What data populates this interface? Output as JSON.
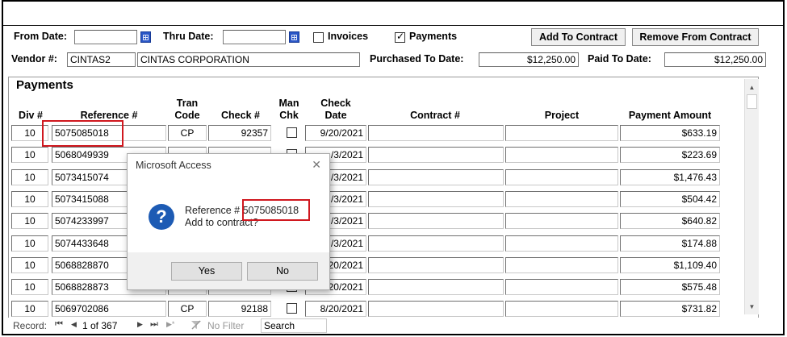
{
  "filters": {
    "from_date_label": "From Date:",
    "from_date_value": "",
    "thru_date_label": "Thru Date:",
    "thru_date_value": "",
    "invoices_label": "Invoices",
    "invoices_checked": false,
    "payments_label": "Payments",
    "payments_checked": true,
    "add_to_contract": "Add To Contract",
    "remove_from_contract": "Remove From Contract",
    "vendor_label": "Vendor #:",
    "vendor_code": "CINTAS2",
    "vendor_name": "CINTAS CORPORATION",
    "purchased_label": "Purchased To Date:",
    "purchased_value": "$12,250.00",
    "paid_label": "Paid To Date:",
    "paid_value": "$12,250.00"
  },
  "payments": {
    "title": "Payments",
    "headers": {
      "div": "Div #",
      "reference": "Reference #",
      "tran_code_1": "Tran",
      "tran_code_2": "Code",
      "check": "Check #",
      "man_chk_1": "Man",
      "man_chk_2": "Chk",
      "check_date_1": "Check",
      "check_date_2": "Date",
      "contract": "Contract #",
      "project": "Project",
      "amount": "Payment Amount"
    },
    "rows": [
      {
        "div": "10",
        "reference": "5075085018",
        "tran": "CP",
        "check": "92357",
        "date": "9/20/2021",
        "contract": "",
        "project": "",
        "amount": "$633.19"
      },
      {
        "div": "10",
        "reference": "5068049939",
        "tran": "",
        "check": "",
        "date": "/3/2021",
        "contract": "",
        "project": "",
        "amount": "$223.69"
      },
      {
        "div": "10",
        "reference": "5073415074",
        "tran": "",
        "check": "",
        "date": "/3/2021",
        "contract": "",
        "project": "",
        "amount": "$1,476.43"
      },
      {
        "div": "10",
        "reference": "5073415088",
        "tran": "",
        "check": "",
        "date": "/3/2021",
        "contract": "",
        "project": "",
        "amount": "$504.42"
      },
      {
        "div": "10",
        "reference": "5074233997",
        "tran": "",
        "check": "",
        "date": "/3/2021",
        "contract": "",
        "project": "",
        "amount": "$640.82"
      },
      {
        "div": "10",
        "reference": "5074433648",
        "tran": "",
        "check": "",
        "date": "/3/2021",
        "contract": "",
        "project": "",
        "amount": "$174.88"
      },
      {
        "div": "10",
        "reference": "5068828870",
        "tran": "",
        "check": "",
        "date": "/20/2021",
        "contract": "",
        "project": "",
        "amount": "$1,109.40"
      },
      {
        "div": "10",
        "reference": "5068828873",
        "tran": "",
        "check": "",
        "date": "/20/2021",
        "contract": "",
        "project": "",
        "amount": "$575.48"
      },
      {
        "div": "10",
        "reference": "5069702086",
        "tran": "CP",
        "check": "92188",
        "date": "8/20/2021",
        "contract": "",
        "project": "",
        "amount": "$731.82"
      }
    ]
  },
  "navbar": {
    "record_label": "Record:",
    "position": "1 of 367",
    "no_filter": "No Filter",
    "search": "Search"
  },
  "dialog": {
    "title": "Microsoft Access",
    "close_glyph": "✕",
    "line1_prefix": "Reference #",
    "line1_ref": "5075085018",
    "line2": "Add to contract?",
    "yes": "Yes",
    "no": "No"
  },
  "colors": {
    "highlight_red": "#d0181f",
    "question_blue": "#1d5bb4",
    "calendar_blue": "#2a56c6"
  },
  "icons": {
    "calendar": "calendar-icon",
    "question": "question-icon",
    "nav_first": "⏮",
    "nav_prev": "◀",
    "nav_next": "▶",
    "nav_last": "⏭",
    "nav_new": "▶*",
    "filter": "no-filter-icon"
  }
}
